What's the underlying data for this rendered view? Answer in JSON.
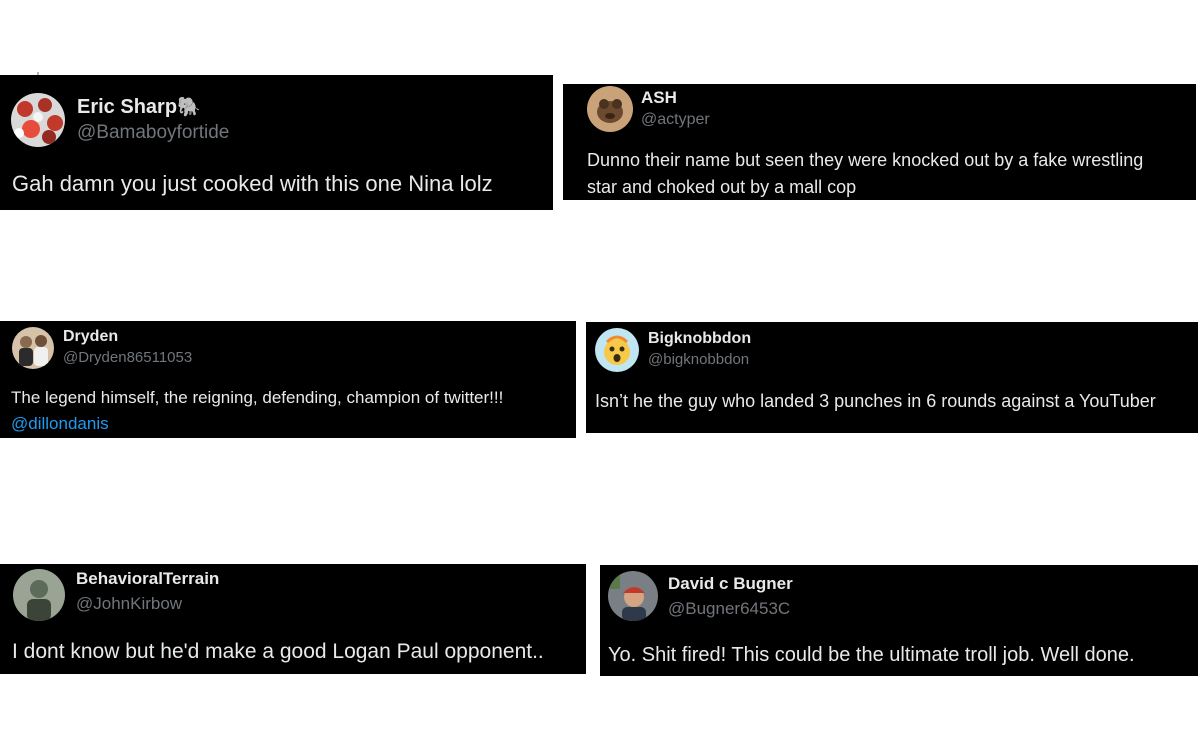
{
  "tweets": [
    {
      "name": "Eric Sharp",
      "name_emoji": "🐘",
      "handle": "@Bamaboyfortide",
      "text": "Gah damn you just cooked with this one Nina lolz",
      "avatar_color": "#c0392b"
    },
    {
      "name": "ASH",
      "handle": "@actyper",
      "text_line1": "Dunno their name but seen they were knocked out by a fake wrestling",
      "text_line2": "star and choked out by a mall cop",
      "avatar_color": "#6b4a2f"
    },
    {
      "name": "Dryden",
      "handle": "@Dryden86511053",
      "text": "The legend himself, the reigning, defending, champion of twitter!!!",
      "mention": "@dillondanis",
      "avatar_color": "#8a6a4f"
    },
    {
      "name": "Bigknobbdon",
      "handle": "@bigknobbdon",
      "text": "Isn’t he the guy who landed 3 punches in 6 rounds against a YouTuber",
      "avatar_color": "#bfe6f2"
    },
    {
      "name": "BehavioralTerrain",
      "handle": "@JohnKirbow",
      "text": "I dont know but he'd make a good Logan Paul opponent..",
      "avatar_color": "#5d6b5a"
    },
    {
      "name": "David c Bugner",
      "handle": "@Bugner6453C",
      "text": "Yo. Shit fired!  This could be the ultimate troll job. Well done.",
      "avatar_color": "#7a7f86"
    }
  ],
  "colors": {
    "card_bg": "#000000",
    "name": "#e7e9ea",
    "handle": "#71767b",
    "mention": "#1d9bf0"
  }
}
